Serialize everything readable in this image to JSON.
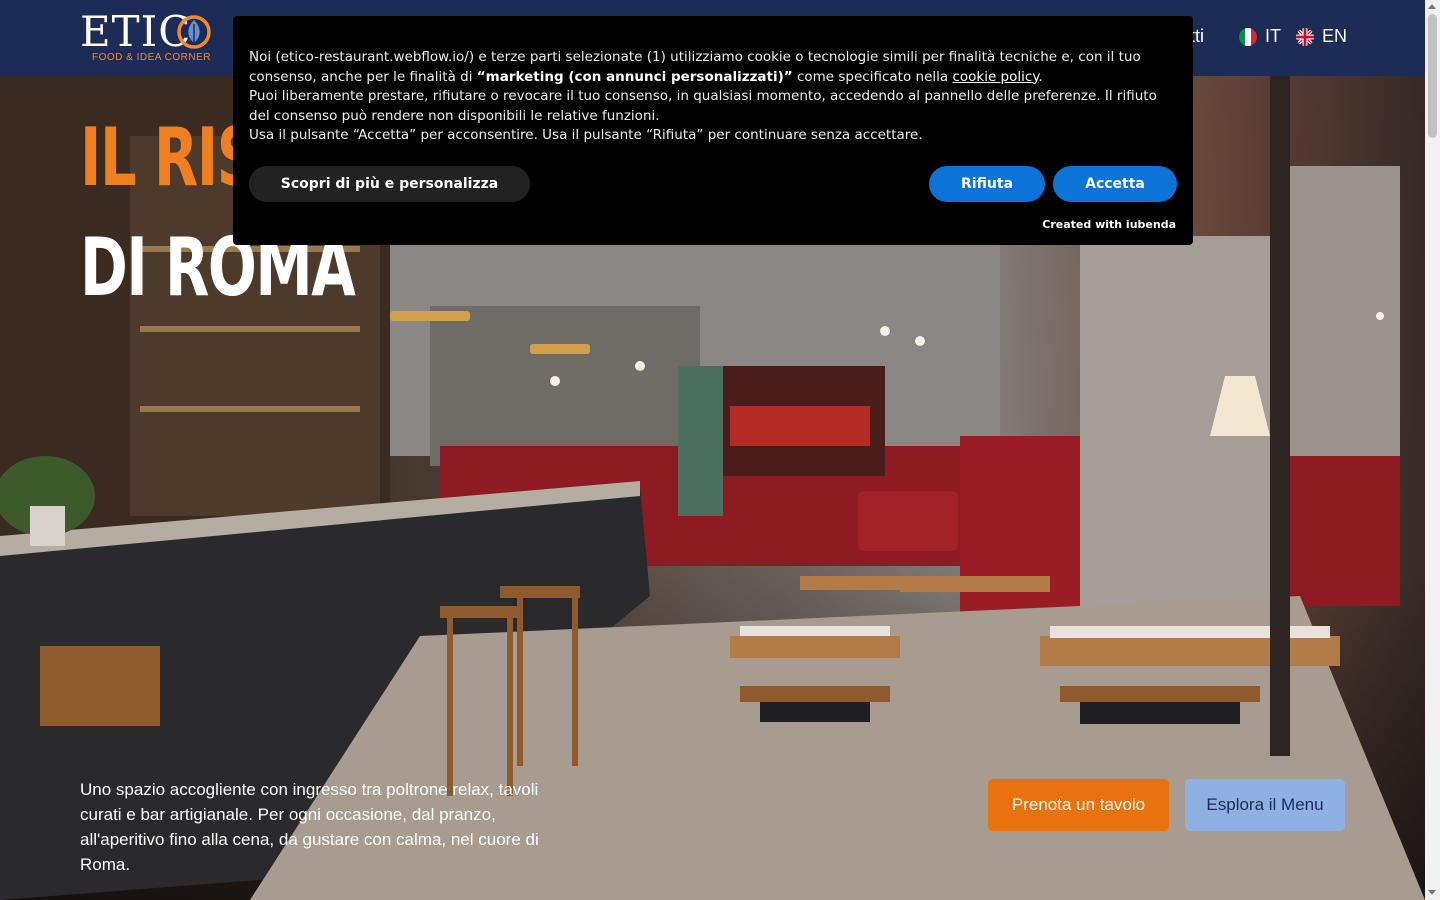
{
  "header": {
    "logo_word": "ETIC",
    "logo_tagline": "FOOD & IDEA CORNER",
    "nav_partial": "atti",
    "languages": [
      {
        "code": "IT"
      },
      {
        "code": "EN"
      }
    ]
  },
  "hero": {
    "title_line1": "IL RIS",
    "title_line2": "DI ROMA",
    "description": "Uno spazio accogliente con ingresso tra poltrone relax, tavoli curati e bar artigianale. Per ogni occasione, dal pranzo, all'aperitivo fino alla cena, da gustare con calma, nel cuore di Roma.",
    "buttons": {
      "book": "Prenota un tavolo",
      "menu": "Esplora il Menu"
    }
  },
  "cookie": {
    "p1_a": "Noi (etico-restaurant.webflow.io/) e terze parti selezionate (1) utilizziamo cookie o tecnologie simili per finalità tecniche e, con il tuo consenso, anche per le finalità di ",
    "p1_bold": "“marketing (con annunci personalizzati)”",
    "p1_b": " come specificato nella ",
    "p1_link": "cookie policy",
    "p1_c": ".",
    "p2": "Puoi liberamente prestare, rifiutare o revocare il tuo consenso, in qualsiasi momento, accedendo al pannello delle preferenze. Il rifiuto del consenso può rendere non disponibili le relative funzioni.",
    "p3": "Usa il pulsante “Accetta” per acconsentire. Usa il pulsante “Rifiuta” per continuare senza accettare.",
    "btn_more": "Scopri di più e personalizza",
    "btn_reject": "Rifiuta",
    "btn_accept": "Accetta",
    "credit": "Created with iubenda"
  },
  "colors": {
    "header_bg": "#1d2c57",
    "accent_orange": "#e8720d",
    "cookie_blue": "#0c73d8",
    "menu_btn": "#8fb0e3"
  }
}
